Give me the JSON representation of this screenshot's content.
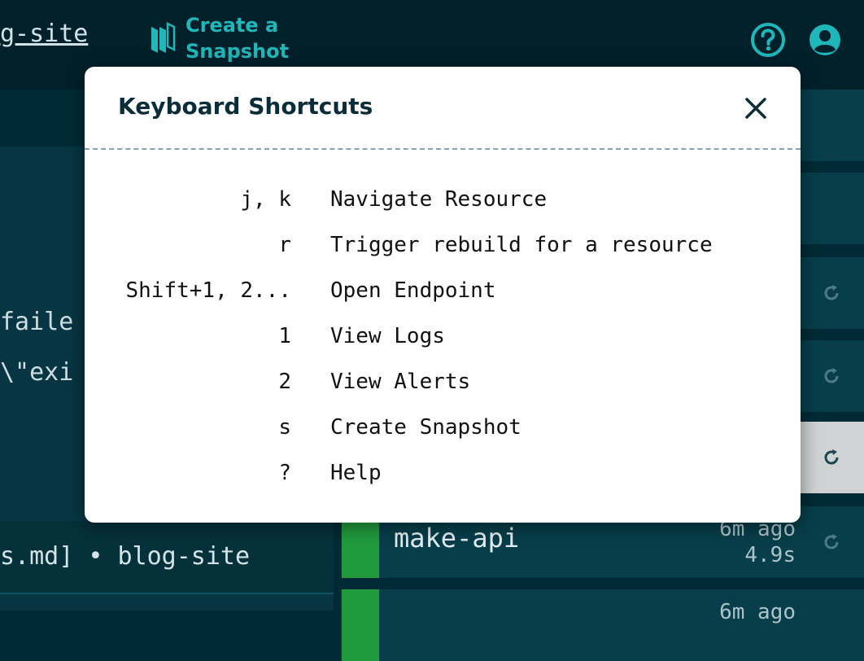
{
  "header": {
    "site_title": "g-site",
    "snapshot_label": "Create a Snapshot"
  },
  "log": {
    "lines": [
      "faile",
      "\\\"exi"
    ],
    "footer": "s.md] • blog-site"
  },
  "resources": [
    {
      "name": "",
      "time": "",
      "duration": "",
      "status_color": "#209a3c"
    },
    {
      "name": "",
      "time": "",
      "duration": "",
      "status_color": "#209a3c"
    },
    {
      "name": "",
      "time": "",
      "duration": "",
      "status_color": "#209a3c"
    },
    {
      "name": "",
      "time": "",
      "duration": "",
      "status_color": "#209a3c"
    },
    {
      "name": "",
      "time": "",
      "duration": "",
      "status_color": "#209a3c"
    },
    {
      "name": "make-api",
      "time": "6m ago",
      "duration": "4.9s",
      "status_color": "#209a3c"
    },
    {
      "name": "",
      "time": "6m ago",
      "duration": "",
      "status_color": "#209a3c"
    }
  ],
  "modal": {
    "title": "Keyboard Shortcuts",
    "shortcuts": [
      {
        "keys": "j, k",
        "description": "Navigate Resource"
      },
      {
        "keys": "r",
        "description": "Trigger rebuild for a resource"
      },
      {
        "keys": "Shift+1, 2...",
        "description": "Open Endpoint"
      },
      {
        "keys": "1",
        "description": "View Logs"
      },
      {
        "keys": "2",
        "description": "View Alerts"
      },
      {
        "keys": "s",
        "description": "Create Snapshot"
      },
      {
        "keys": "?",
        "description": "Help"
      }
    ]
  },
  "colors": {
    "background": "#002b36",
    "accent": "#20b7ba",
    "status_ok": "#209a3c",
    "modal_bg": "#ffffff",
    "modal_title": "#0a2d38"
  },
  "icons": {
    "snapshot": "book-stack-icon",
    "help": "question-circle-icon",
    "user": "user-circle-icon",
    "close": "close-icon",
    "rebuild": "refresh-icon"
  }
}
